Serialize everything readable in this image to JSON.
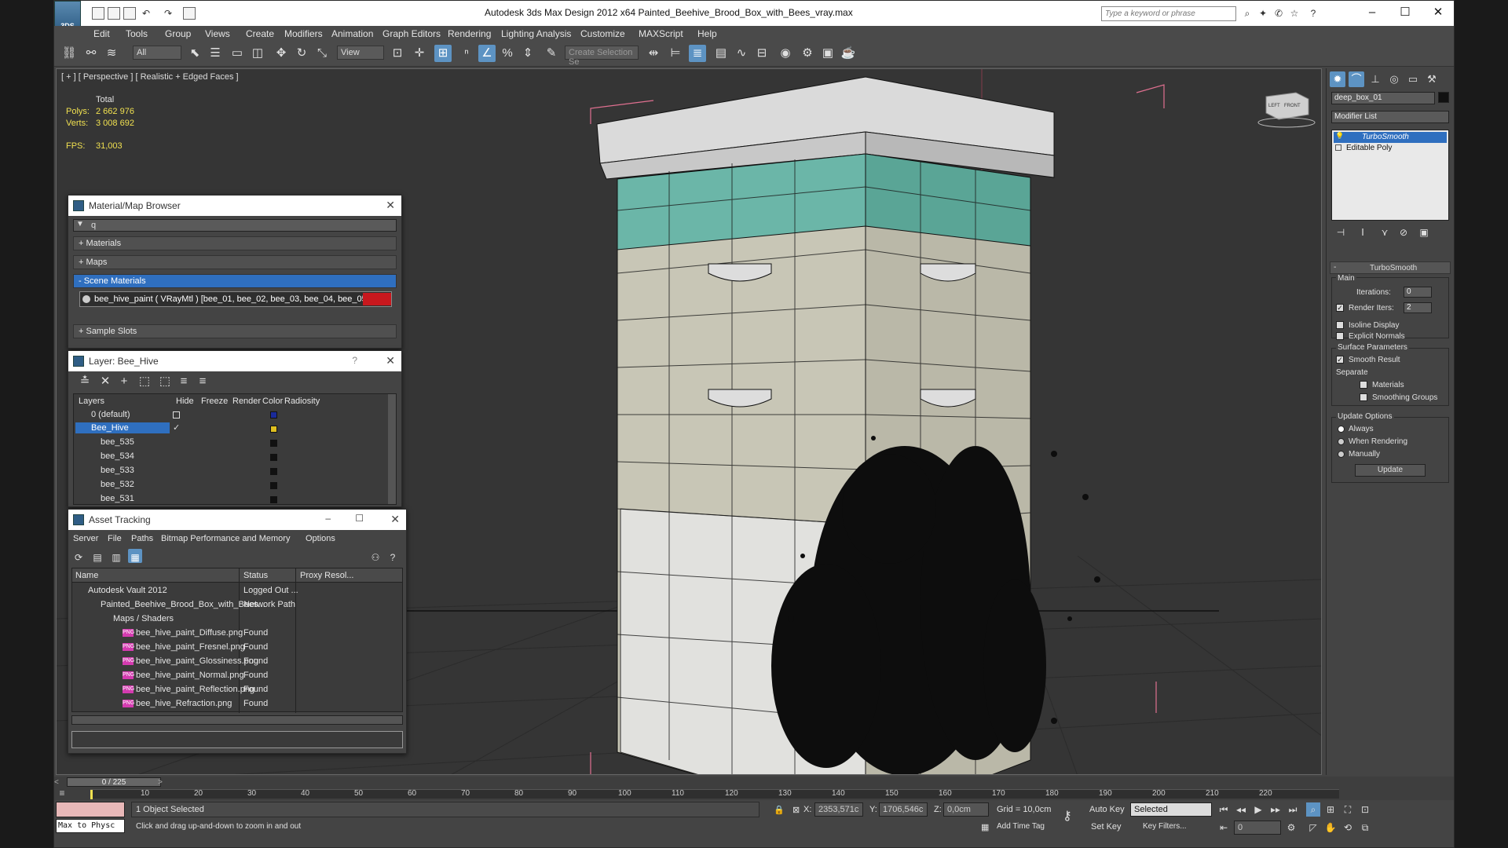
{
  "app": {
    "logo_text": "3DS",
    "window_title": "Autodesk 3ds Max Design 2012 x64      Painted_Beehive_Brood_Box_with_Bees_vray.max",
    "search_placeholder": "Type a keyword or phrase"
  },
  "menu": [
    "Edit",
    "Tools",
    "Group",
    "Views",
    "Create",
    "Modifiers",
    "Animation",
    "Graph Editors",
    "Rendering",
    "Lighting Analysis",
    "Customize",
    "MAXScript",
    "Help"
  ],
  "toolbar": {
    "selection_filter": "All",
    "ref_coord": "View",
    "named_selection_placeholder": "Create Selection Se"
  },
  "viewport": {
    "label": "[ + ] [ Perspective ] [ Realistic + Edged Faces ]",
    "stats": {
      "total_label": "Total",
      "polys_label": "Polys:",
      "polys_value": "2 662 976",
      "verts_label": "Verts:",
      "verts_value": "3 008 692",
      "fps_label": "FPS:",
      "fps_value": "31,003"
    },
    "viewcube_labels": [
      "LEFT",
      "FRONT"
    ]
  },
  "material_browser": {
    "title": "Material/Map Browser",
    "search_value": "q",
    "sections": [
      "+ Materials",
      "+ Maps",
      "- Scene Materials",
      "+ Sample Slots"
    ],
    "scene_material": "bee_hive_paint  ( VRayMtl )  [bee_01, bee_02, bee_03, bee_04, bee_05, bee..."
  },
  "layer_dialog": {
    "title": "Layer: Bee_Hive",
    "help": "?",
    "columns": [
      "Layers",
      "Hide",
      "Freeze",
      "Render",
      "Color",
      "Radiosity"
    ],
    "rows": [
      {
        "name": "0 (default)",
        "color": "#1a2a9a"
      },
      {
        "name": "Bee_Hive",
        "color": "#e0c020"
      },
      {
        "name": "bee_535",
        "color": "#111111"
      },
      {
        "name": "bee_534",
        "color": "#111111"
      },
      {
        "name": "bee_533",
        "color": "#111111"
      },
      {
        "name": "bee_532",
        "color": "#111111"
      },
      {
        "name": "bee_531",
        "color": "#111111"
      }
    ]
  },
  "asset_tracking": {
    "title": "Asset Tracking",
    "menu": [
      "Server",
      "File",
      "Paths",
      "Bitmap Performance and Memory",
      "Options"
    ],
    "columns": [
      "Name",
      "Status",
      "Proxy Resol..."
    ],
    "rows": [
      {
        "name": "Autodesk Vault 2012",
        "status": "Logged Out ..."
      },
      {
        "name": "Painted_Beehive_Brood_Box_with_Bees...",
        "status": "Network Path"
      },
      {
        "name": "Maps / Shaders",
        "status": ""
      },
      {
        "name": "bee_hive_paint_Diffuse.png",
        "status": "Found"
      },
      {
        "name": "bee_hive_paint_Fresnel.png",
        "status": "Found"
      },
      {
        "name": "bee_hive_paint_Glossiness.png",
        "status": "Found"
      },
      {
        "name": "bee_hive_paint_Normal.png",
        "status": "Found"
      },
      {
        "name": "bee_hive_paint_Reflection.png",
        "status": "Found"
      },
      {
        "name": "bee_hive_Refraction.png",
        "status": "Found"
      }
    ],
    "png_badge": "PNG"
  },
  "command_panel": {
    "object_name": "deep_box_01",
    "modifier_list": "Modifier List",
    "stack": [
      "TurboSmooth",
      "Editable Poly"
    ],
    "rollout_title": "TurboSmooth",
    "main_group": "Main",
    "iterations_label": "Iterations:",
    "iterations_value": "0",
    "render_iters_label": "Render Iters:",
    "render_iters_value": "2",
    "isoline_label": "Isoline Display",
    "explicit_normals_label": "Explicit Normals",
    "surface_group": "Surface Parameters",
    "smooth_result_label": "Smooth Result",
    "separate_label": "Separate",
    "materials_label": "Materials",
    "smoothing_groups_label": "Smoothing Groups",
    "update_group": "Update Options",
    "always_label": "Always",
    "when_rendering_label": "When Rendering",
    "manually_label": "Manually",
    "update_button": "Update"
  },
  "timeline": {
    "frame_counter": "0 / 225",
    "ticks": [
      "10",
      "20",
      "30",
      "40",
      "50",
      "60",
      "70",
      "80",
      "90",
      "100",
      "110",
      "120",
      "130",
      "140",
      "150",
      "160",
      "170",
      "180",
      "190",
      "200",
      "210",
      "220"
    ]
  },
  "status": {
    "max_to_physc": "Max to Physc",
    "objects_selected": "1 Object Selected",
    "prompt": "Click and drag up-and-down to zoom in and out",
    "x_label": "X:",
    "x_value": "2353,571c",
    "y_label": "Y:",
    "y_value": "1706,546c",
    "z_label": "Z:",
    "z_value": "0,0cm",
    "grid": "Grid = 10,0cm",
    "add_time_tag": "Add Time Tag",
    "auto_key": "Auto Key",
    "auto_key_mode": "Selected",
    "set_key": "Set Key",
    "key_filters": "Key Filters...",
    "current_frame": "0"
  }
}
